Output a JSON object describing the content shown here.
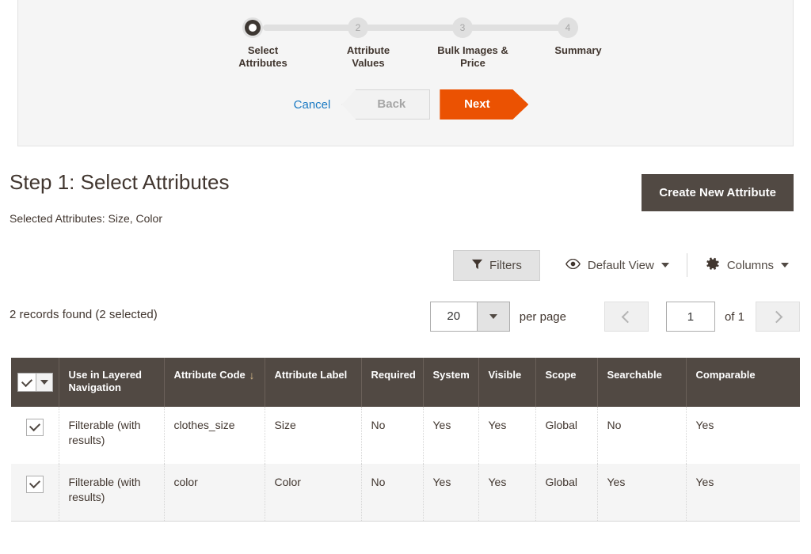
{
  "wizard": {
    "steps": [
      {
        "number": "1",
        "label": "Select\nAttributes",
        "label_line1": "Select",
        "label_line2": "Attributes",
        "active": true
      },
      {
        "number": "2",
        "label_line1": "Attribute",
        "label_line2": "Values",
        "active": false
      },
      {
        "number": "3",
        "label_line1": "Bulk Images &",
        "label_line2": "Price",
        "active": false
      },
      {
        "number": "4",
        "label_line1": "Summary",
        "label_line2": "",
        "active": false
      }
    ],
    "cancel_label": "Cancel",
    "back_label": "Back",
    "next_label": "Next",
    "accent_color": "#eb5202"
  },
  "page": {
    "title": "Step 1: Select Attributes",
    "selected_attributes": "Selected Attributes: Size, Color",
    "create_attribute_label": "Create New Attribute",
    "create_attribute_color": "#514943"
  },
  "toolbar": {
    "filters_label": "Filters",
    "view_label": "Default View",
    "columns_label": "Columns"
  },
  "pagination": {
    "records_found": "2 records found (2 selected)",
    "per_page_value": "20",
    "per_page_label": "per page",
    "current_page": "1",
    "of_label": "of 1"
  },
  "grid": {
    "columns": [
      {
        "key": "check",
        "label": ""
      },
      {
        "key": "layered",
        "label": "Use in Layered Navigation"
      },
      {
        "key": "code",
        "label": "Attribute Code",
        "sorted": "asc",
        "sort_glyph": "↓"
      },
      {
        "key": "attr_label",
        "label": "Attribute Label"
      },
      {
        "key": "required",
        "label": "Required"
      },
      {
        "key": "system",
        "label": "System"
      },
      {
        "key": "visible",
        "label": "Visible"
      },
      {
        "key": "scope",
        "label": "Scope"
      },
      {
        "key": "searchable",
        "label": "Searchable"
      },
      {
        "key": "comparable",
        "label": "Comparable"
      }
    ],
    "rows": [
      {
        "checked": true,
        "layered": "Filterable (with results)",
        "code": "clothes_size",
        "attr_label": "Size",
        "required": "No",
        "system": "Yes",
        "visible": "Yes",
        "scope": "Global",
        "searchable": "No",
        "comparable": "Yes"
      },
      {
        "checked": true,
        "layered": "Filterable (with results)",
        "code": "color",
        "attr_label": "Color",
        "required": "No",
        "system": "Yes",
        "visible": "Yes",
        "scope": "Global",
        "searchable": "Yes",
        "comparable": "Yes"
      }
    ]
  }
}
